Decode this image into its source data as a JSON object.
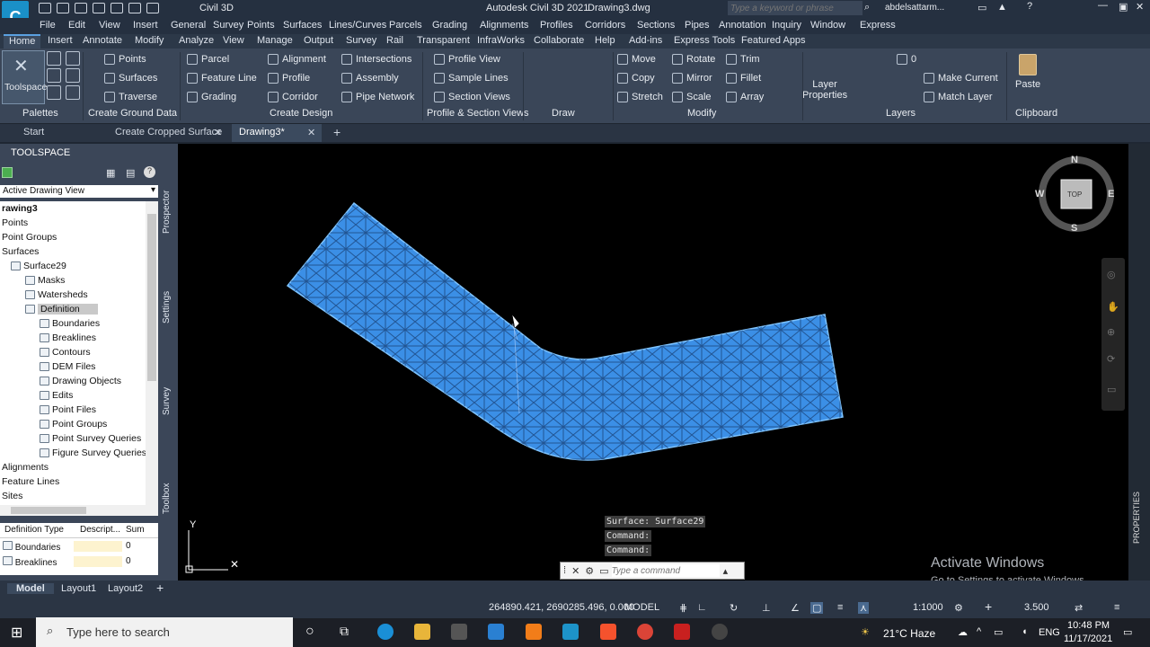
{
  "app": {
    "title": "Autodesk Civil 3D 2021",
    "file": "Drawing3.dwg",
    "workspace": "Civil 3D",
    "search_placeholder": "Type a keyword or phrase",
    "user": "abdelsattarm..."
  },
  "menu": [
    "File",
    "Edit",
    "View",
    "Insert",
    "General",
    "Survey",
    "Points",
    "Surfaces",
    "Lines/Curves",
    "Parcels",
    "Grading",
    "Alignments",
    "Profiles",
    "Corridors",
    "Sections",
    "Pipes",
    "Annotation",
    "Inquiry",
    "Window",
    "Express"
  ],
  "ribbon_tabs": [
    "Home",
    "Insert",
    "Annotate",
    "Modify",
    "Analyze",
    "View",
    "Manage",
    "Output",
    "Survey",
    "Rail",
    "Transparent",
    "InfraWorks",
    "Collaborate",
    "Help",
    "Add-ins",
    "Express Tools",
    "Featured Apps"
  ],
  "ribbon": {
    "toolspace": "Toolspace",
    "ground": [
      "Points",
      "Surfaces",
      "Traverse"
    ],
    "design_a": [
      "Parcel",
      "Feature Line",
      "Grading"
    ],
    "design_b": [
      "Alignment",
      "Profile",
      "Corridor"
    ],
    "design_c": [
      "Intersections",
      "Assembly",
      "Pipe Network"
    ],
    "profile": [
      "Profile View",
      "Sample Lines",
      "Section Views"
    ],
    "modify_a": [
      "Move",
      "Copy",
      "Stretch"
    ],
    "modify_b": [
      "Rotate",
      "Mirror",
      "Scale"
    ],
    "modify_c": [
      "Trim",
      "Fillet",
      "Array"
    ],
    "layer_props": "Layer Properties",
    "layer_name": "0",
    "layer_cmds": [
      "Make Current",
      "Match Layer"
    ],
    "paste": "Paste",
    "groups": [
      "Palettes",
      "Create Ground Data",
      "Create Design",
      "Profile & Section Views",
      "Draw",
      "Modify",
      "Layers",
      "Clipboard"
    ]
  },
  "doc_tabs": [
    "Start",
    "Create Cropped Surface",
    "Drawing3*"
  ],
  "toolspace": {
    "title": "TOOLSPACE",
    "view": "Active Drawing View",
    "tree": [
      {
        "label": "rawing3",
        "level": 0,
        "bold": true
      },
      {
        "label": "Points",
        "level": 0
      },
      {
        "label": "Point Groups",
        "level": 0
      },
      {
        "label": "Surfaces",
        "level": 0
      },
      {
        "label": "Surface29",
        "level": 1
      },
      {
        "label": "Masks",
        "level": 2
      },
      {
        "label": "Watersheds",
        "level": 2
      },
      {
        "label": "Definition",
        "level": 2,
        "selected": true
      },
      {
        "label": "Boundaries",
        "level": 3
      },
      {
        "label": "Breaklines",
        "level": 3
      },
      {
        "label": "Contours",
        "level": 3
      },
      {
        "label": "DEM Files",
        "level": 3
      },
      {
        "label": "Drawing Objects",
        "level": 3
      },
      {
        "label": "Edits",
        "level": 3
      },
      {
        "label": "Point Files",
        "level": 3
      },
      {
        "label": "Point Groups",
        "level": 3
      },
      {
        "label": "Point Survey Queries",
        "level": 3
      },
      {
        "label": "Figure Survey Queries",
        "level": 3
      },
      {
        "label": "Alignments",
        "level": 0
      },
      {
        "label": "Feature Lines",
        "level": 0
      },
      {
        "label": "Sites",
        "level": 0
      }
    ],
    "side_tabs": [
      "Prospector",
      "Settings",
      "Survey",
      "Toolbox"
    ],
    "table_headers": [
      "Definition Type",
      "Descript...",
      "Sum"
    ],
    "table_rows": [
      [
        "Boundaries",
        "",
        "0"
      ],
      [
        "Breaklines",
        "",
        "0"
      ]
    ]
  },
  "viewcube": {
    "n": "N",
    "s": "S",
    "e": "E",
    "w": "W",
    "face": "TOP"
  },
  "ucs": {
    "y": "Y"
  },
  "command": {
    "history": [
      "Surface:  Surface29",
      "Command:",
      "Command:"
    ],
    "placeholder": "Type a command"
  },
  "watermark": {
    "line1": "Activate Windows",
    "line2": "Go to Settings to activate Windows."
  },
  "side_panel_label": "PROPERTIES",
  "layout_tabs": [
    "Model",
    "Layout1",
    "Layout2"
  ],
  "status": {
    "coords": "264890.421, 2690285.496, 0.000",
    "mode": "MODEL",
    "scale": "1:1000",
    "lineweight": "3.500"
  },
  "taskbar": {
    "search": "Type here to search",
    "weather": "21°C  Haze",
    "lang": "ENG",
    "time": "10:48 PM",
    "date": "11/17/2021"
  },
  "colors": {
    "surface": "#3b8fe6",
    "ribbon": "#3a4658",
    "accent": "#5aa0e0"
  }
}
